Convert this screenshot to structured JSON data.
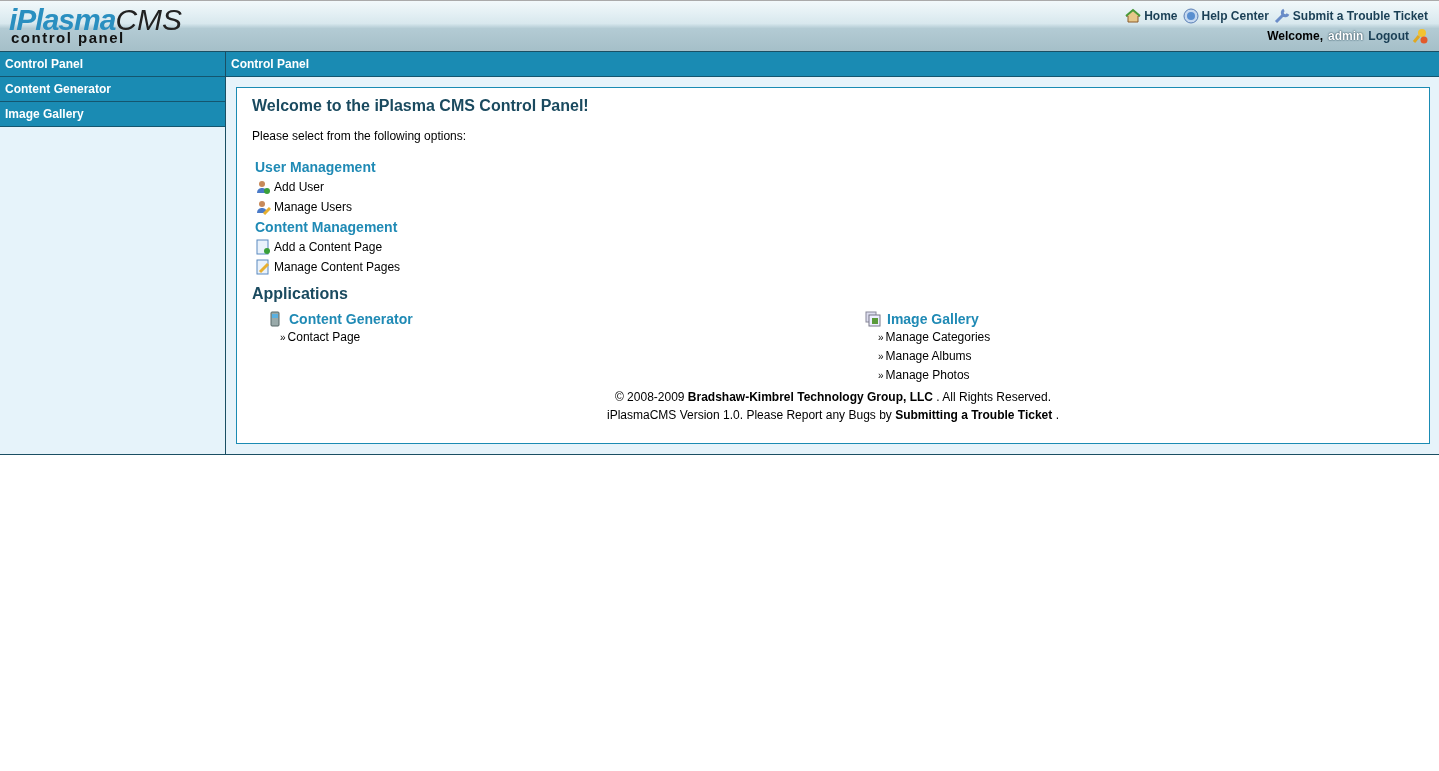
{
  "logo": {
    "brand_part1": "iPlasma",
    "brand_part2": "CMS",
    "subtitle": "control panel"
  },
  "top_links": [
    {
      "kind": "home",
      "label": "Home"
    },
    {
      "kind": "help",
      "label": "Help Center"
    },
    {
      "kind": "ticket",
      "label": "Submit a Trouble Ticket"
    }
  ],
  "user_bar": {
    "welcome": "Welcome,",
    "username": "admin",
    "logout": "Logout"
  },
  "sidebar": {
    "items": [
      {
        "label": "Control Panel"
      },
      {
        "label": "Content Generator"
      },
      {
        "label": "Image Gallery"
      }
    ]
  },
  "page_header": "Control Panel",
  "content": {
    "title": "Welcome to the iPlasma CMS Control Panel!",
    "intro": "Please select from the following options:",
    "sections": [
      {
        "heading": "User Management",
        "links": [
          {
            "kind": "user-add",
            "label": "Add User"
          },
          {
            "kind": "user-edit",
            "label": "Manage Users"
          }
        ]
      },
      {
        "heading": "Content Management",
        "links": [
          {
            "kind": "page-add",
            "label": "Add a Content Page"
          },
          {
            "kind": "page-edit",
            "label": "Manage Content Pages"
          }
        ]
      }
    ],
    "applications": {
      "heading": "Applications",
      "apps": [
        {
          "kind": "phone",
          "title": "Content Generator",
          "links": [
            {
              "marker": "»",
              "label": "Contact Page"
            }
          ]
        },
        {
          "kind": "gallery",
          "title": "Image Gallery",
          "links": [
            {
              "marker": "»",
              "label": "Manage Categories"
            },
            {
              "marker": "»",
              "label": "Manage Albums"
            },
            {
              "marker": "»",
              "label": "Manage Photos"
            }
          ]
        }
      ]
    },
    "footer": [
      {
        "before": "© 2008-2009",
        "link": "Bradshaw-Kimbrel Technology Group, LLC",
        "after": ". All Rights Reserved."
      },
      {
        "before": "iPlasmaCMS Version 1.0. Please Report any Bugs by",
        "link": "Submitting a Trouble Ticket",
        "after": "."
      }
    ]
  }
}
